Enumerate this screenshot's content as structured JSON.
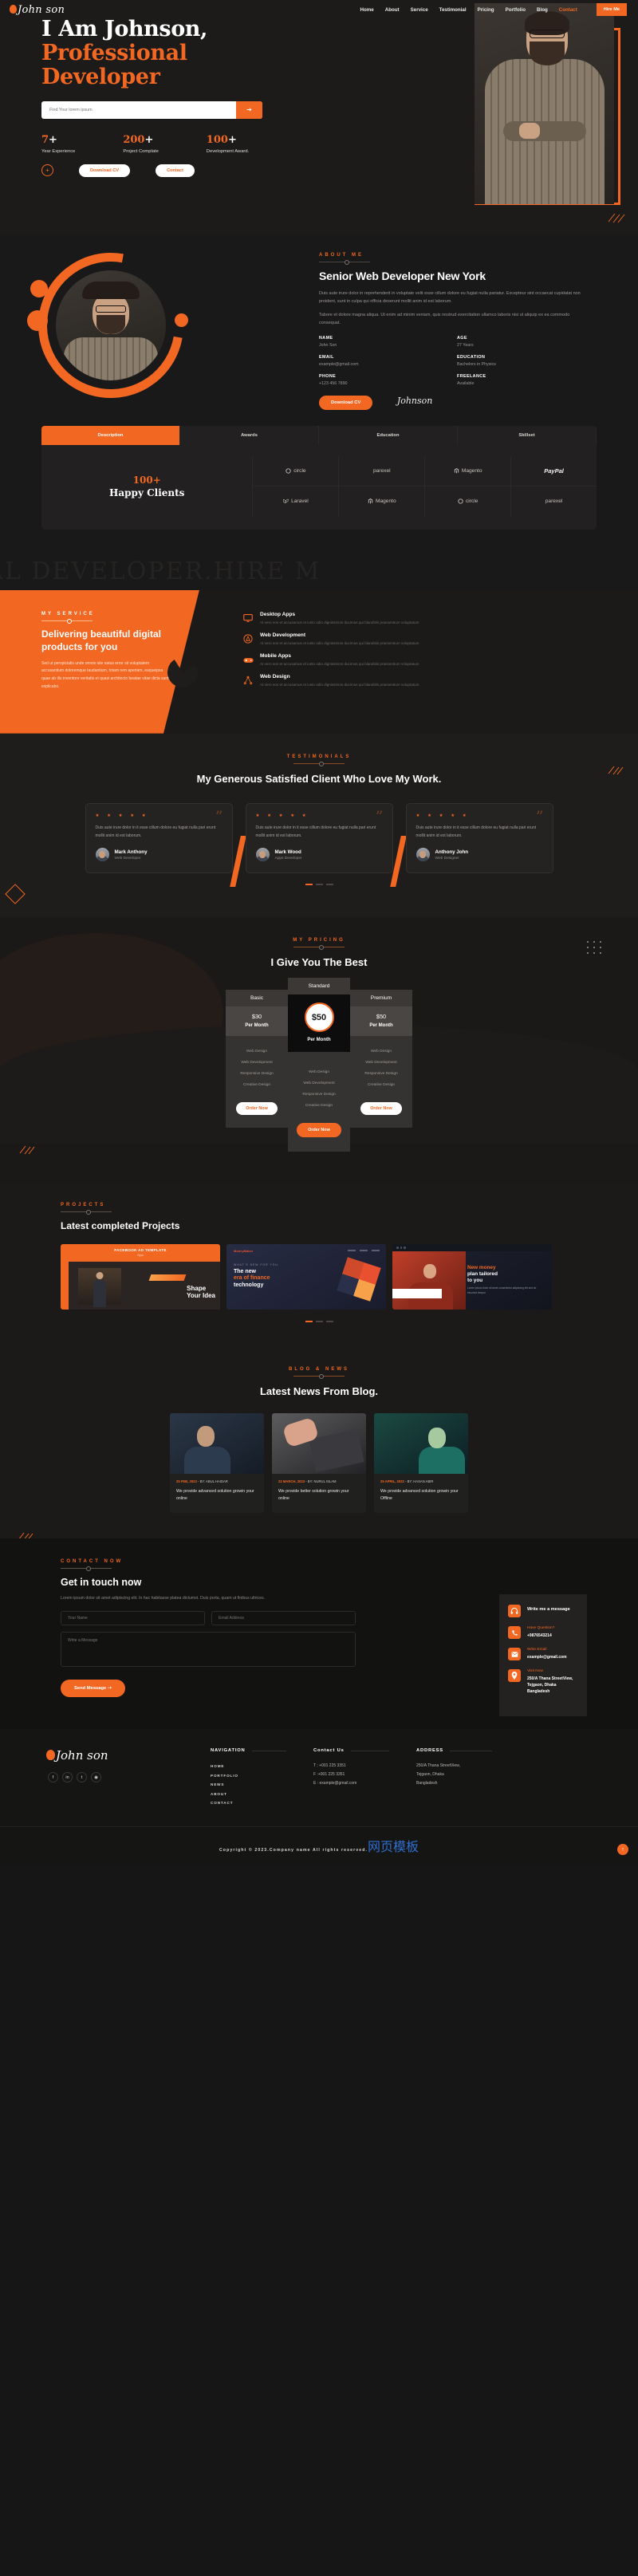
{
  "nav": {
    "logo": "John son",
    "links": [
      "Home",
      "About",
      "Service",
      "Testimonial",
      "Pricing",
      "Portfolio",
      "Blog",
      "Contact"
    ],
    "active": "Contact",
    "cta": "Hire Me"
  },
  "hero": {
    "title_line1": "I Am Johnson,",
    "title_line2": "Professional",
    "title_line3": "Developer",
    "search_placeholder": "Find Your lorem ipsum",
    "search_value": "",
    "search_icon": "arrow-right-icon",
    "stats": [
      {
        "num": "7",
        "plus": "+",
        "label": "Year Experience"
      },
      {
        "num": "200",
        "plus": "+",
        "label": "Project Complate"
      },
      {
        "num": "100",
        "plus": "+",
        "label": "Development Award."
      }
    ],
    "plus_icon": "plus-icon",
    "download_cv": "Download CV",
    "contact": "Contact"
  },
  "about": {
    "eyebrow": "ABOUT ME",
    "title": "Senior Web Developer New York",
    "para1": "Duis aute irure dolor in reprehenderit in voluptate velit esse cillum dolore eu fugiat nulla pariatur. Excepteur sint occaecat cupidatat non proident, sunt in culpa qui officia deserunt mollit anim id est laborum.",
    "para2": "Tabore et dolore magna aliqua. Ut enim ad minim veniam, quis nostrud exercitation ullamco laboris nisi ut aliquip ex ea commodo consequat.",
    "info": [
      {
        "k": "NAME",
        "v": "John Son"
      },
      {
        "k": "AGE",
        "v": "27 Years"
      },
      {
        "k": "EMAIL",
        "v": "example@gmail.com"
      },
      {
        "k": "EDUCATION",
        "v": "Bachelors in Physics"
      },
      {
        "k": "PHONE",
        "v": "+123 456 7890"
      },
      {
        "k": "FREELANCE",
        "v": "Available"
      }
    ],
    "download_cv": "Download CV",
    "signature": "Johnson"
  },
  "tabs": {
    "items": [
      "Description",
      "Awards",
      "Education",
      "Skillset"
    ],
    "active": "Description",
    "clients_num": "100+",
    "clients_label": "Happy Clients",
    "brands_row1": [
      "circle",
      "parexel",
      "Magento",
      "PayPal"
    ],
    "brands_row2": [
      "Laravel",
      "Magento",
      "circle",
      "parexel"
    ]
  },
  "marquee": {
    "text": "NAL DEVELOPER.HIRE M"
  },
  "service": {
    "eyebrow": "MY SERVICE",
    "title": "Delivering beautiful digital products for you",
    "para": "Sed ut perspiciatis unde omnis iste natus error sit voluptatem accusantium doloremque laudantium, totam rem aperiam, eaqueipsa quae ab illo inventore veritatis et quasi architecto beatae vitae dicta sunt explicabo.",
    "items": [
      {
        "icon": "desktop-icon",
        "title": "Desktop Apps",
        "desc": "At vero eos et accusamus et iusto odio dignissimos ducimus qui blanditiis praesentium voluptatum"
      },
      {
        "icon": "appstore-icon",
        "title": "Web Development",
        "desc": "At vero eos et accusamus et iusto odio dignissimos ducimus qui blanditiis praesentium voluptatum"
      },
      {
        "icon": "gamepad-icon",
        "title": "Mobile Apps",
        "desc": "At vero eos et accusamus et iusto odio dignissimos ducimus qui blanditiis praesentium voluptatum"
      },
      {
        "icon": "vector-node-icon",
        "title": "Web Design",
        "desc": "At vero eos et accusamus et iusto odio dignissimos ducimus qui blanditiis praesentium voluptatum"
      }
    ]
  },
  "testimonials": {
    "eyebrow": "TESTIMONIALS",
    "title": "My Generous Satisfied Client Who Love My Work.",
    "stars": "★ ★ ★ ★ ★",
    "cards": [
      {
        "quote": "Duis aute irure dolor in it esse cillum dolore eu fugiat nulla pari erunt mollit anim id est laborum.",
        "name": "Mark Anthony",
        "role": "Web Developer"
      },
      {
        "quote": "Duis aute irure dolor in it esse cillum dolore eu fugiat nulla pari erunt mollit anim id est laborum.",
        "name": "Mark Wood",
        "role": "Apps Developer"
      },
      {
        "quote": "Duis aute irure dolor in it esse cillum dolore eu fugiat nulla pari erunt mollit anim id est laborum.",
        "name": "Anthony John",
        "role": "Web Designer"
      }
    ]
  },
  "pricing": {
    "eyebrow": "MY PRICING",
    "title": "I Give You The Best",
    "features": [
      "Web Design",
      "Web Development",
      "Responsive Design",
      "Creative Design"
    ],
    "order": "Order Now",
    "plans": [
      {
        "name": "Basic",
        "price": "$30",
        "period": "Per Month"
      },
      {
        "name": "Standard",
        "price": "$50",
        "period": "Per Month"
      },
      {
        "name": "Premium",
        "price": "$50",
        "period": "Per Month"
      }
    ]
  },
  "projects": {
    "eyebrow": "PROJECTS",
    "title": "Latest completed Projects",
    "card1": {
      "label": "FACEBOOK AD TEMPLATE",
      "sub": "Gym",
      "headline_a": "Shape",
      "headline_b": "Your Idea"
    },
    "card2": {
      "logo": "MoneyMaker",
      "kicker": "WHAT'S NEW FOR YOU",
      "headline_a": "The new",
      "headline_b": "era of finance",
      "headline_c": "technology"
    },
    "card3": {
      "headline_a": "New money",
      "headline_b": "plan tailored",
      "headline_c": "to you",
      "desc": "Lorem ipsum dolor sit amet consectetur adipiscing elit sed do eiusmod tempor"
    }
  },
  "blog": {
    "eyebrow": "BLOG & NEWS",
    "title": "Latest News From Blog.",
    "posts": [
      {
        "date": "25 FEB, 2023",
        "author": "- BY: ABUL HAIDAR",
        "title": "We provide advanced solution growin your online"
      },
      {
        "date": "22 MARCH, 2023",
        "author": "- BY: NURUL ISLAM",
        "title": "We provide better solution growin your online"
      },
      {
        "date": "25 APRIL, 2022",
        "author": "- BY: HASAN ABIR",
        "title": "We provide advanced solution growin your Offline"
      }
    ]
  },
  "contact": {
    "eyebrow": "CONTACT NOW",
    "title": "Get in touch now",
    "para": "Lorem ipsum dolor sit amet adipiscing elit. In hac habitasse platea dictumst. Duis porta, quam ut finibus ultrices.",
    "name_placeholder": "Your Name",
    "email_placeholder": "Email Address",
    "message_placeholder": "Write a Message",
    "send": "Send Message ➝",
    "card": {
      "headset_icon": "headset-icon",
      "heading": "Write me a message",
      "rows": [
        {
          "icon": "phone-icon",
          "k": "Have Question?",
          "v": "+9876543214"
        },
        {
          "icon": "mail-icon",
          "k": "Write Email",
          "v": "example@gmail.com"
        },
        {
          "icon": "location-icon",
          "k": "Visit Now",
          "v": "250/A Thana StreetView, Tejgaon, Dhaka Bangladesh"
        }
      ]
    }
  },
  "footer": {
    "logo": "John son",
    "socials": [
      "f",
      "in",
      "t",
      "◉"
    ],
    "nav_heading": "NAVIGATION",
    "nav_items": [
      "HOME",
      "PORTFOLIO",
      "NEWS",
      "ABOUT",
      "CONTACT"
    ],
    "contact_heading": "Contact Us",
    "contact_lines": [
      "T : +001 225 3351",
      "F :+001 225 3351",
      "E : example@gmail.com"
    ],
    "address_heading": "ADDRESS",
    "address_lines": [
      "250/A Thana StreetView,",
      "Tejgaon, Dhaka",
      "Bangladesh"
    ],
    "copyright": "Copyright © 2023.Company name All rights reserved.",
    "copyright_suffix": "网页模板",
    "top_icon": "arrow-up-icon"
  }
}
